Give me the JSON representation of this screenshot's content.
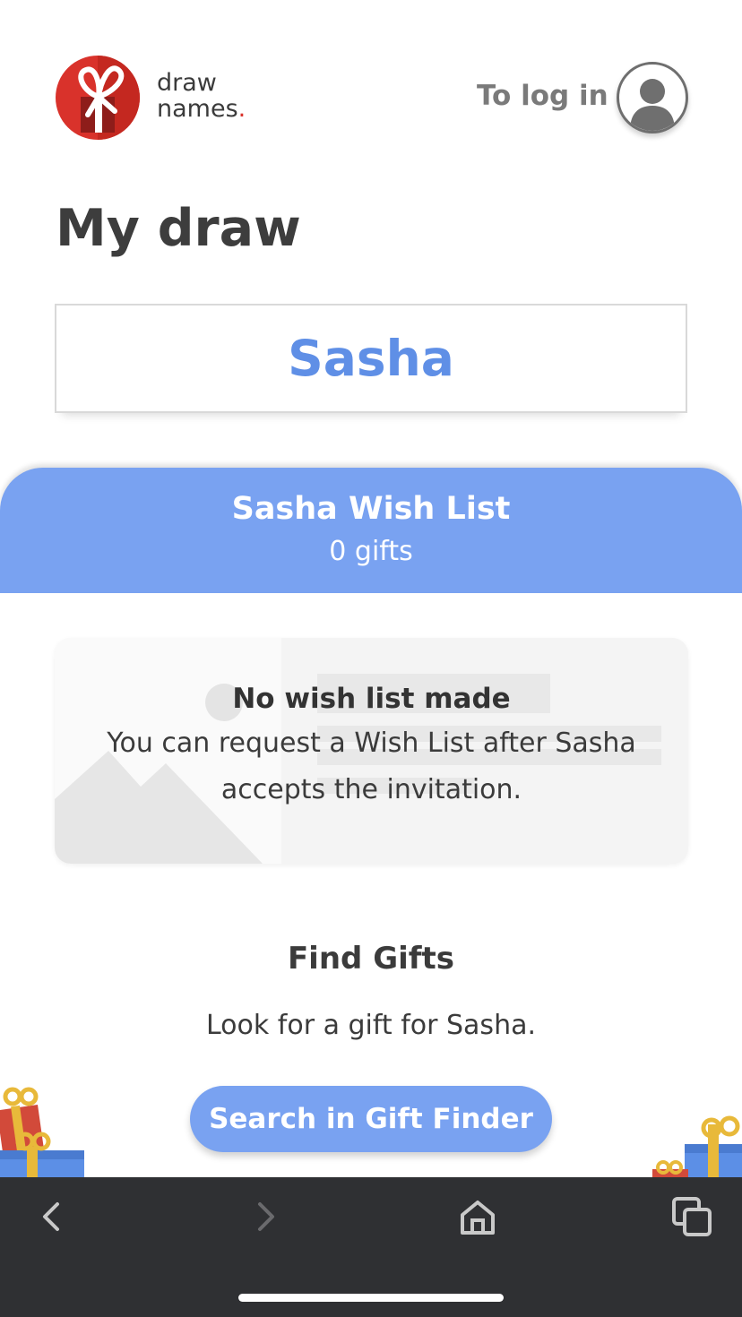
{
  "header": {
    "logo_line1": "draw",
    "logo_line2": "names",
    "logo_dot": ".",
    "login_label": "To log in",
    "brand_color": "#d9322b"
  },
  "page": {
    "title": "My draw",
    "drawn_name": "Sasha"
  },
  "wish_list": {
    "title": "Sasha Wish List",
    "count": "0 gifts",
    "empty_title": "No wish list made",
    "empty_desc_line1": "You can request a Wish List after Sasha",
    "empty_desc_line2": "accepts the invitation."
  },
  "find_gifts": {
    "title": "Find Gifts",
    "description": "Look for a gift for Sasha.",
    "button_label": "Search in Gift Finder"
  },
  "colors": {
    "accent": "#79a2f1",
    "name_color": "#5f8fe6",
    "browser_bar": "#2f3033"
  },
  "browser_nav": {
    "icons": [
      "chevron-left-icon",
      "chevron-right-icon",
      "home-icon",
      "tabs-icon"
    ]
  }
}
